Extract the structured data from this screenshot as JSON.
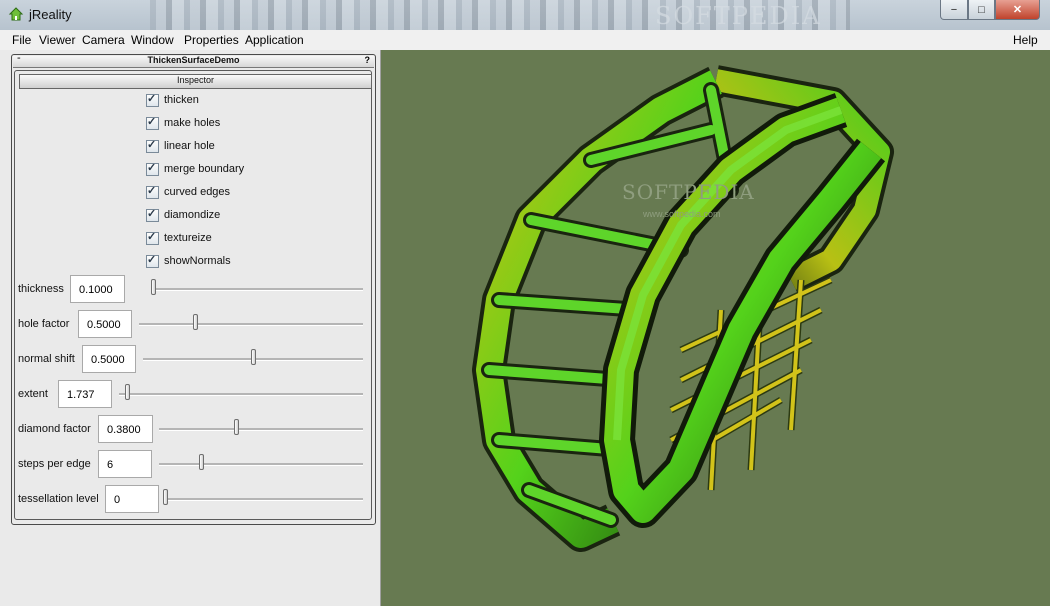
{
  "window": {
    "title": "jReality",
    "watermark": "SOFTPEDIA",
    "buttons": {
      "min": "−",
      "max": "□",
      "close": "✕"
    }
  },
  "menu": [
    "File",
    "Viewer",
    "Camera",
    "Window",
    "Properties",
    "Application",
    "Help"
  ],
  "panel": {
    "frame_title": "ThickenSurfaceDemo",
    "frame_left": "-",
    "frame_right": "?",
    "inspector_title": "Inspector",
    "checkboxes": [
      {
        "label": "thicken",
        "checked": true
      },
      {
        "label": "make holes",
        "checked": true
      },
      {
        "label": "linear hole",
        "checked": true
      },
      {
        "label": "merge boundary",
        "checked": true
      },
      {
        "label": "curved edges",
        "checked": true
      },
      {
        "label": "diamondize",
        "checked": true
      },
      {
        "label": "textureize",
        "checked": true
      },
      {
        "label": "showNormals",
        "checked": true
      }
    ],
    "sliders": [
      {
        "label": "thickness",
        "value": "0.1000",
        "position": 0.0
      },
      {
        "label": "hole factor",
        "value": "0.5000",
        "position": 0.25
      },
      {
        "label": "normal shift",
        "value": "0.5000",
        "position": 0.5
      },
      {
        "label": "extent",
        "value": "1.737",
        "position": 0.0
      },
      {
        "label": "diamond factor",
        "value": "0.3800",
        "position": 0.38
      },
      {
        "label": "steps per edge",
        "value": "6",
        "position": 0.2
      },
      {
        "label": "tessellation level",
        "value": "0",
        "position": 0.0
      }
    ]
  },
  "viewport": {
    "background": "#677a51",
    "watermark": "SOFTPEDIA",
    "watermark_url": "www.softpedia.com"
  },
  "colors": {
    "green": "#42d21a",
    "yellow": "#c8c010",
    "dark": "#1a2410"
  }
}
